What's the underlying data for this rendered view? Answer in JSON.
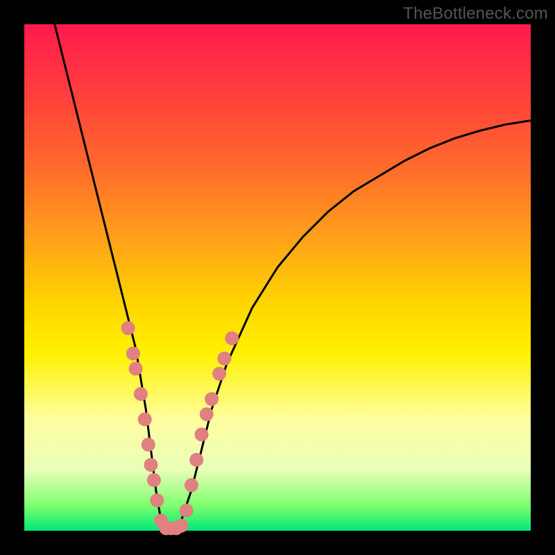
{
  "watermark": "TheBottleneck.com",
  "chart_data": {
    "type": "line",
    "title": "",
    "xlabel": "",
    "ylabel": "",
    "xlim": [
      0,
      100
    ],
    "ylim": [
      0,
      100
    ],
    "grid": false,
    "series": [
      {
        "name": "bottleneck-curve",
        "x": [
          6,
          8,
          10,
          12,
          14,
          16,
          18,
          20,
          22,
          24,
          25,
          26,
          27,
          28,
          29,
          30,
          31,
          33,
          35,
          37,
          40,
          45,
          50,
          55,
          60,
          65,
          70,
          75,
          80,
          85,
          90,
          95,
          100
        ],
        "y": [
          100,
          92,
          84,
          76,
          68,
          60,
          52,
          44,
          36,
          24,
          16,
          8,
          2,
          0,
          0,
          0,
          2,
          8,
          16,
          24,
          33,
          44,
          52,
          58,
          63,
          67,
          70,
          73,
          75.5,
          77.5,
          79,
          80.2,
          81
        ]
      }
    ],
    "markers": {
      "name": "highlighted-points",
      "color": "#e08080",
      "radius_px": 10,
      "points": [
        {
          "x": 20.5,
          "y": 40
        },
        {
          "x": 21.5,
          "y": 35
        },
        {
          "x": 22.0,
          "y": 32
        },
        {
          "x": 23.0,
          "y": 27
        },
        {
          "x": 23.8,
          "y": 22
        },
        {
          "x": 24.5,
          "y": 17
        },
        {
          "x": 25.0,
          "y": 13
        },
        {
          "x": 25.6,
          "y": 10
        },
        {
          "x": 26.2,
          "y": 6
        },
        {
          "x": 27.0,
          "y": 2
        },
        {
          "x": 28.0,
          "y": 0.5
        },
        {
          "x": 29.0,
          "y": 0.5
        },
        {
          "x": 30.0,
          "y": 0.5
        },
        {
          "x": 31.0,
          "y": 1
        },
        {
          "x": 32.0,
          "y": 4
        },
        {
          "x": 33.0,
          "y": 9
        },
        {
          "x": 34.0,
          "y": 14
        },
        {
          "x": 35.0,
          "y": 19
        },
        {
          "x": 36.0,
          "y": 23
        },
        {
          "x": 37.0,
          "y": 26
        },
        {
          "x": 38.5,
          "y": 31
        },
        {
          "x": 39.5,
          "y": 34
        },
        {
          "x": 41.0,
          "y": 38
        }
      ]
    },
    "background_gradient": {
      "orientation": "vertical",
      "stops": [
        {
          "pos": 0.0,
          "color": "#ff1a4d"
        },
        {
          "pos": 0.28,
          "color": "#ff6a2c"
        },
        {
          "pos": 0.55,
          "color": "#ffd400"
        },
        {
          "pos": 0.78,
          "color": "#fffea0"
        },
        {
          "pos": 0.95,
          "color": "#7fff6e"
        },
        {
          "pos": 1.0,
          "color": "#00e87a"
        }
      ]
    }
  }
}
